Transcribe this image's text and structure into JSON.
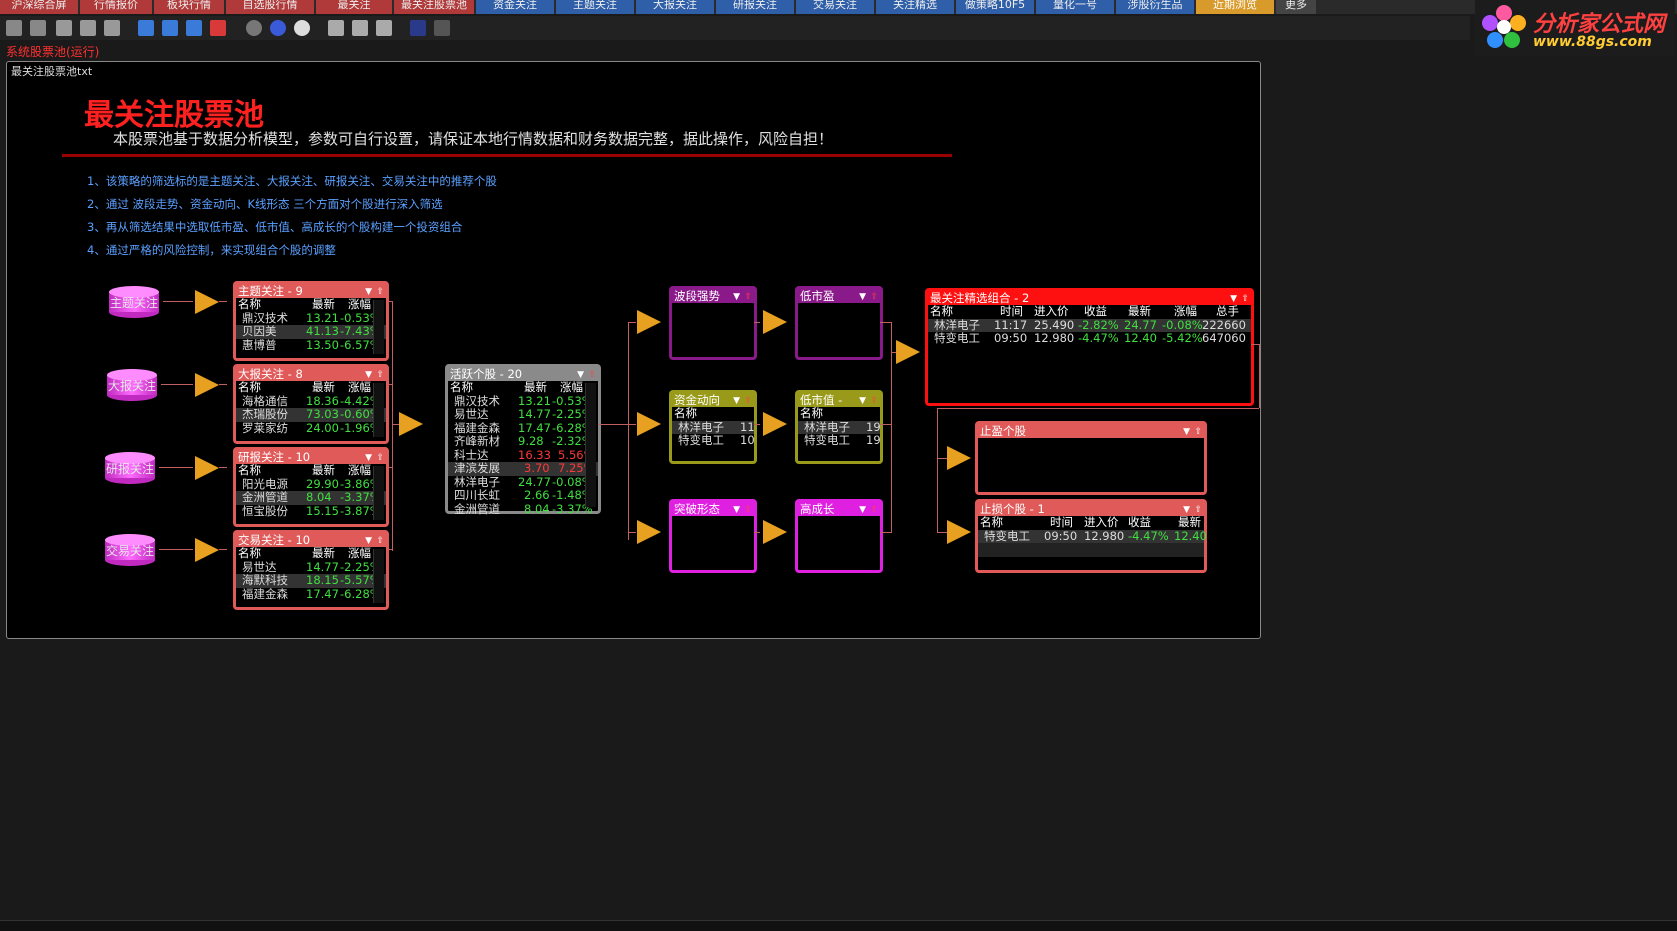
{
  "tabs": [
    {
      "label": "沪深综合屏"
    },
    {
      "label": "行情报价"
    },
    {
      "label": "板块行情"
    },
    {
      "label": "自选股行情"
    },
    {
      "label": "最关注"
    },
    {
      "label": "最关注股票池"
    },
    {
      "label": "资金关注"
    },
    {
      "label": "主题关注"
    },
    {
      "label": "大报关注"
    },
    {
      "label": "研报关注"
    },
    {
      "label": "交易关注"
    },
    {
      "label": "关注精选"
    },
    {
      "label": "做策略10F5"
    },
    {
      "label": "量化一号"
    },
    {
      "label": "涉股衍生品"
    },
    {
      "label": "近期浏览"
    },
    {
      "label": "更多"
    }
  ],
  "logo": {
    "title": "分析家公式网",
    "url_text": "www.88gs.com"
  },
  "status_run": "系统股票池(运行)",
  "frame_title": "最关注股票池txt",
  "page_title": "最关注股票池",
  "subtitle": "本股票池基于数据分析模型，参数可自行设置，请保证本地行情数据和财务数据完整，据此操作，风险自担！",
  "notes": [
    "1、该策略的筛选标的是主题关注、大报关注、研报关注、交易关注中的推荐个股",
    "2、通过 波段走势、资金动向、K线形态 三个方面对个股进行深入筛选",
    "3、再从筛选结果中选取低市盈、低市值、高成长的个股构建一个投资组合",
    "4、通过严格的风险控制，来实现组合个股的调整"
  ],
  "sources": [
    {
      "label": "主题关注"
    },
    {
      "label": "大报关注"
    },
    {
      "label": "研报关注"
    },
    {
      "label": "交易关注"
    }
  ],
  "col": {
    "name": "名称",
    "latest": "最新",
    "change": "涨幅",
    "time": "时间",
    "entry": "进入价",
    "gain": "收益",
    "total": "总手"
  },
  "colors": {
    "red_panel": "#e05a5a",
    "purple": "#8a1a8a",
    "olive": "#9a9a1a",
    "magenta": "#e020e0",
    "bright_red": "#ff1010",
    "gray_panel": "#8a8a8a"
  },
  "source_panels": [
    {
      "title": "主题关注 - 9",
      "rows": [
        {
          "name": "鼎汉技术",
          "latest": "13.21",
          "change": "-0.53%"
        },
        {
          "name": "贝因美",
          "latest": "41.13",
          "change": "-7.43%"
        },
        {
          "name": "惠博普",
          "latest": "13.50",
          "change": "-6.57%"
        }
      ]
    },
    {
      "title": "大报关注 - 8",
      "rows": [
        {
          "name": "海格通信",
          "latest": "18.36",
          "change": "-4.42%"
        },
        {
          "name": "杰瑞股份",
          "latest": "73.03",
          "change": "-0.60%"
        },
        {
          "name": "罗莱家纺",
          "latest": "24.00",
          "change": "-1.96%"
        }
      ]
    },
    {
      "title": "研报关注 - 10",
      "rows": [
        {
          "name": "阳光电源",
          "latest": "29.90",
          "change": "-3.86%"
        },
        {
          "name": "金洲管道",
          "latest": "8.04",
          "change": "-3.37%"
        },
        {
          "name": "恒宝股份",
          "latest": "15.15",
          "change": "-3.87%"
        }
      ]
    },
    {
      "title": "交易关注 - 10",
      "rows": [
        {
          "name": "易世达",
          "latest": "14.77",
          "change": "-2.25%"
        },
        {
          "name": "海默科技",
          "latest": "18.15",
          "change": "-5.57%"
        },
        {
          "name": "福建金森",
          "latest": "17.47",
          "change": "-6.28%"
        }
      ]
    }
  ],
  "active_panel": {
    "title": "活跃个股 - 20",
    "rows": [
      {
        "name": "鼎汉技术",
        "latest": "13.21",
        "change": "-0.53%",
        "dir": "dn"
      },
      {
        "name": "易世达",
        "latest": "14.77",
        "change": "-2.25%",
        "dir": "dn"
      },
      {
        "name": "福建金森",
        "latest": "17.47",
        "change": "-6.28%",
        "dir": "dn"
      },
      {
        "name": "齐峰新材",
        "latest": "9.28",
        "change": "-2.32%",
        "dir": "dn"
      },
      {
        "name": "科士达",
        "latest": "16.33",
        "change": "5.56%",
        "dir": "up"
      },
      {
        "name": "津滨发展",
        "latest": "3.70",
        "change": "7.25%",
        "dir": "up"
      },
      {
        "name": "林洋电子",
        "latest": "24.77",
        "change": "-0.08%",
        "dir": "dn"
      },
      {
        "name": "四川长虹",
        "latest": "2.66",
        "change": "-1.48%",
        "dir": "dn"
      },
      {
        "name": "金洲管道",
        "latest": "8.04",
        "change": "-3.37%",
        "dir": "dn"
      }
    ],
    "overflow": "2",
    "overflow2": "3"
  },
  "filter_panels": {
    "wave": {
      "title": "波段强势"
    },
    "capital": {
      "title": "资金动向",
      "rows": [
        {
          "name": "林洋电子",
          "v": "11"
        },
        {
          "name": "特变电工",
          "v": "10"
        }
      ]
    },
    "breakout": {
      "title": "突破形态"
    },
    "low_pe": {
      "title": "低市盈"
    },
    "low_cap": {
      "title": "低市值 -",
      "rows": [
        {
          "name": "林洋电子",
          "v": "19"
        },
        {
          "name": "特变电工",
          "v": "19"
        }
      ]
    },
    "growth": {
      "title": "高成长"
    }
  },
  "portfolio": {
    "title": "最关注精选组合 - 2",
    "rows": [
      {
        "name": "林洋电子",
        "time": "11:17",
        "entry": "25.490",
        "gain": "-2.82%",
        "latest": "24.77",
        "change": "-0.08%",
        "total": "222660"
      },
      {
        "name": "特变电工",
        "time": "09:50",
        "entry": "12.980",
        "gain": "-4.47%",
        "latest": "12.40",
        "change": "-5.42%",
        "total": "647060"
      }
    ]
  },
  "take_profit": {
    "title": "止盈个股"
  },
  "stop_loss": {
    "title": "止损个股 - 1",
    "rows": [
      {
        "name": "特变电工",
        "time": "09:50",
        "entry": "12.980",
        "gain": "-4.47%",
        "latest": "12.40"
      }
    ],
    "latest_col": "最新"
  }
}
